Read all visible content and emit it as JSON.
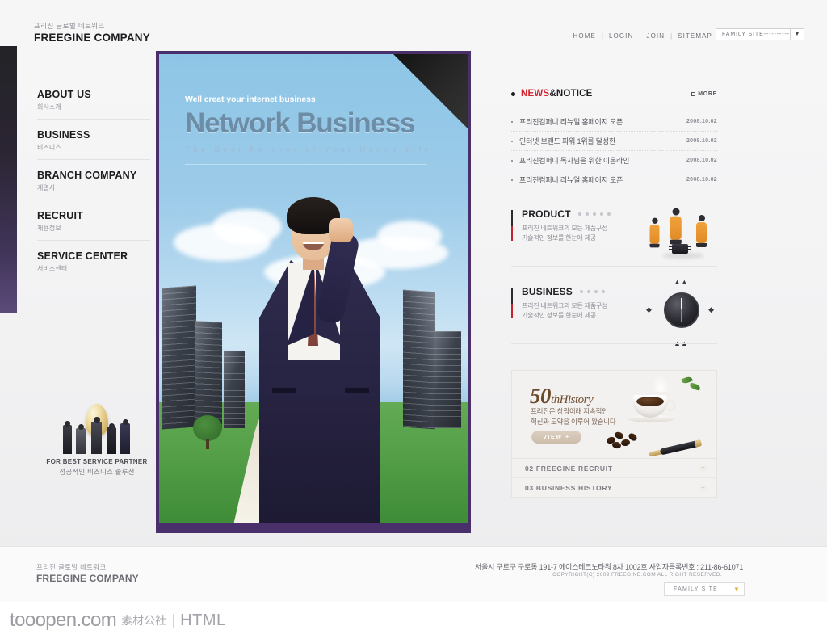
{
  "header": {
    "logo_sub": "프리진 글로벌 네트워크",
    "logo_main": "FREEGINE COMPANY",
    "nav": [
      {
        "label": "HOME"
      },
      {
        "label": "LOGIN"
      },
      {
        "label": "JOIN"
      },
      {
        "label": "SITEMAP"
      }
    ],
    "separator": "|",
    "family_site": {
      "label": "FAMILY SITE---------------",
      "arrow": "chevron-down-icon"
    }
  },
  "sidebar": {
    "items": [
      {
        "en": "ABOUT US",
        "ko": "회사소개"
      },
      {
        "en": "BUSINESS",
        "ko": "비즈니스"
      },
      {
        "en": "BRANCH COMPANY",
        "ko": "계열사"
      },
      {
        "en": "RECRUIT",
        "ko": "채용정보"
      },
      {
        "en": "SERVICE CENTER",
        "ko": "서비스센터"
      }
    ],
    "promo": {
      "en": "FOR BEST SERVICE PARTNER",
      "ko": "성공적인 비즈니스 솔루션"
    }
  },
  "hero": {
    "kicker": "Well creat your internet business",
    "title": "Network Business",
    "subtitle": "The Best Partner of Your Happy Life"
  },
  "news": {
    "title_red": "NEWS",
    "title_dark": "&NOTICE",
    "more_label": "MORE",
    "items": [
      {
        "title": "프리진컴퍼니 리뉴얼 홈페이지 오픈",
        "date": "2008.10.02"
      },
      {
        "title": "인터넷 브랜드 파워 1위를 달성한",
        "date": "2008.10.02"
      },
      {
        "title": "프리진컴퍼니 독자님을 위한 이온라인",
        "date": "2008.10.02"
      },
      {
        "title": "프리진컴퍼니 리뉴얼 홈페이지 오픈",
        "date": "2008.10.02"
      }
    ]
  },
  "sections": [
    {
      "title": "PRODUCT",
      "desc_line1": "프리진 네트워크의 모든 제품구성",
      "desc_line2": "기술적인 정보를 한눈에 제공",
      "dots": 5,
      "art": "workers-chip-icon"
    },
    {
      "title": "BUSINESS",
      "desc_line1": "프리진 네트워크의 모든 제품구성",
      "desc_line2": "기술적인 정보를 한눈에 제공",
      "dots": 4,
      "art": "compass-icon"
    }
  ],
  "history": {
    "number": "50",
    "th": "th",
    "word": "History",
    "desc_line1": "프리진은 창립이래 지속적인",
    "desc_line2": "혁신과 도약을 이루어 왔습니다",
    "view_label": "VIEW +",
    "list": [
      {
        "label": "02 FREEGINE RECRUIT",
        "plus": "+"
      },
      {
        "label": "03 BUSINESS HISTORY",
        "plus": "+"
      }
    ]
  },
  "footer": {
    "logo_sub": "프리진 글로벌 네트워크",
    "logo_main": "FREEGINE COMPANY",
    "address": "서울시 구로구 구로동 191-7 에이스테크노타워 8차 1002호  사업자등록번호 : 211-86-61071",
    "copyright": "COPYRIGHT(C) 2009 FREEGINE.COM ALL RIGHT RESERVED.",
    "family_site": {
      "label": "FAMILY SITE",
      "arrow": "chevron-down-icon"
    }
  },
  "watermark": {
    "site": "tooopen.com",
    "cn": "素材公社",
    "type": "HTML"
  },
  "colors": {
    "accent_red": "#d0212c",
    "hero_purple": "#49306b",
    "hero_sky": "#8dc3e4",
    "history_brown": "#6c4a2e"
  }
}
